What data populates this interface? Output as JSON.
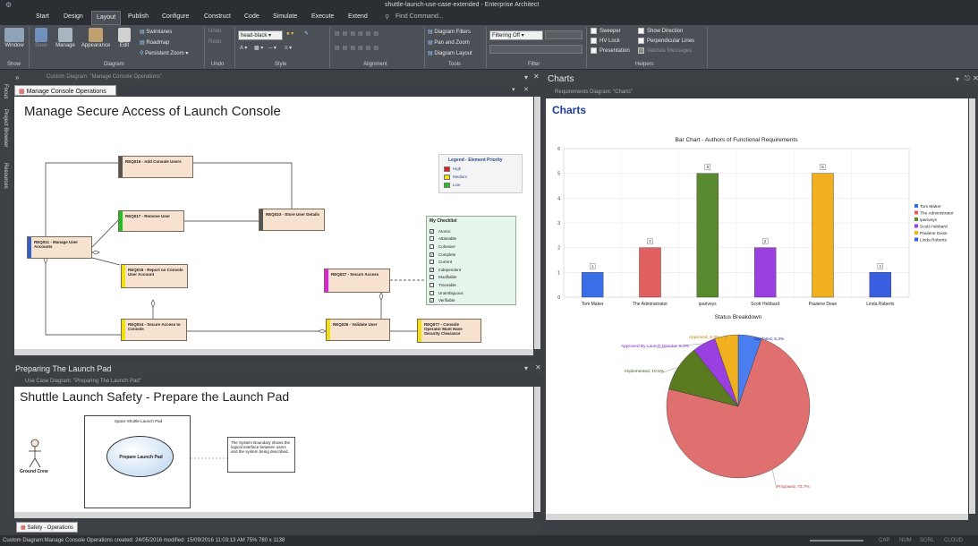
{
  "title": "shuttle-launch-use-case-extended - Enterprise Architect",
  "menu": [
    "Start",
    "Design",
    "Layout",
    "Publish",
    "Configure",
    "Construct",
    "Code",
    "Simulate",
    "Execute",
    "Extend"
  ],
  "find_command": "Find Command...",
  "ribbon": {
    "window": "Window",
    "save": "Save",
    "manage": "Manage",
    "appearance": "Appearance",
    "edit": "Edit",
    "swimlanes": "Swimlanes",
    "roadmap": "Roadmap",
    "persistent_zoom": "Persistent Zoom",
    "undo": "Undo",
    "redo": "Redo",
    "font_value": "head-black",
    "diagram_filters": "Diagram Filters",
    "pan_zoom": "Pan and Zoom",
    "diagram_layout": "Diagram Layout",
    "filtering": "Filtering Off",
    "sweeper": "Sweeper",
    "hv_lock": "HV Lock",
    "presentation": "Presentation",
    "show_direction": "Show Direction",
    "perpendicular_lines": "Perpendicular Lines",
    "validate_messages": "Validate Messages",
    "groups": [
      "Show",
      "Diagram",
      "Undo",
      "Style",
      "Alignment",
      "Tools",
      "Filter",
      "Helpers"
    ]
  },
  "left_strip": [
    "Focus",
    "Project Browser",
    "Resources"
  ],
  "panel1": {
    "header": "Custom Diagram: \"Manage Console Operations\"",
    "tab": "Manage Console Operations",
    "title": "Manage Secure Access of Launch Console",
    "boxes": {
      "req016": "REQ016 - Add Console Users",
      "req017": "REQ017 - Remove User",
      "req023": "REQ023 - Store User Details",
      "req011": "REQ011 - Manage User Accounts",
      "req018": "REQ018 - Report on Console User Account",
      "req027": "REQ027 - Secure Access",
      "req024": "REQ024 - Secure Access to Console",
      "req026": "REQ026 - Validate User",
      "req077": "REQ077 - Console Operator Must Have Security Clearance"
    },
    "legend": {
      "title": "Legend - Element Priority",
      "items": [
        "High",
        "Medium",
        "Low"
      ],
      "colors": [
        "#e02020",
        "#f0e010",
        "#20c020"
      ]
    },
    "checklist": {
      "title": "My Checklist",
      "items": [
        {
          "label": "Atomic",
          "checked": true
        },
        {
          "label": "Attainable",
          "checked": false
        },
        {
          "label": "Cohesive",
          "checked": false
        },
        {
          "label": "Complete",
          "checked": true
        },
        {
          "label": "Current",
          "checked": false
        },
        {
          "label": "Independent",
          "checked": true
        },
        {
          "label": "Modifiable",
          "checked": false
        },
        {
          "label": "Traceable",
          "checked": false
        },
        {
          "label": "Unambiguous",
          "checked": false
        },
        {
          "label": "Verifiable",
          "checked": true
        }
      ]
    }
  },
  "panel2": {
    "header": "Preparing The Launch Pad",
    "breadcrumb": "Use Case Diagram: \"Preparing The Launch Pad\"",
    "title": "Shuttle Launch Safety - Prepare the Launch Pad",
    "boundary": "Space Shuttle Launch Pad",
    "usecase": "Prepare Launch Pad",
    "actor": "Ground Crew",
    "note": "The System Boundary shows the logical interface between users and the system being described."
  },
  "bottom_tab": "Safety - Operations",
  "charts_panel": {
    "header": "Charts",
    "breadcrumb": "Requirements Diagram: \"Charts\"",
    "title": "Charts"
  },
  "chart_data": [
    {
      "type": "bar",
      "title": "Bar Chart - Authors of Functional Requirements",
      "categories": [
        "Tom Maker",
        "The Administrator",
        "ipariveys",
        "Scott Hebbard",
        "Paulene Dean",
        "Linda Roberts"
      ],
      "values": [
        1,
        2,
        5,
        2,
        5,
        1
      ],
      "colors": [
        "#3a6ee8",
        "#e06060",
        "#5a8a30",
        "#9a40e0",
        "#f0b020",
        "#3a5ee0"
      ],
      "ylim": [
        0,
        6
      ],
      "yticks": [
        "0",
        "1",
        "2",
        "3",
        "4",
        "5",
        "6"
      ],
      "legend": [
        "Tom Maker",
        "The Administrator",
        "ipariveys",
        "Scott Hebbard",
        "Paulene Dean",
        "Linda Roberts"
      ],
      "legend_position": "right",
      "grid": true
    },
    {
      "type": "pie",
      "title": "Status Breakdown",
      "slices": [
        {
          "label": "Validated, 5.3%",
          "value": 5.3,
          "color": "#4a7ef0"
        },
        {
          "label": "Proposed, 73.7%",
          "value": 73.7,
          "color": "#e07070"
        },
        {
          "label": "Implemented, 10.5%",
          "value": 10.5,
          "color": "#5a7a20"
        },
        {
          "label": "Approved By Launch Director, 5.3%",
          "value": 5.3,
          "color": "#9a40e0"
        },
        {
          "label": "Approved, 5.3%",
          "value": 5.3,
          "color": "#f0b020"
        }
      ]
    }
  ],
  "status": {
    "text": "Custom Diagram:Manage Console Operations   created: 24/05/2016  modified: 15/09/2016 11:03:13 AM   75%   780 x 1138",
    "indicators": [
      "CAP",
      "NUM",
      "SCRL",
      "CLOUD"
    ]
  }
}
